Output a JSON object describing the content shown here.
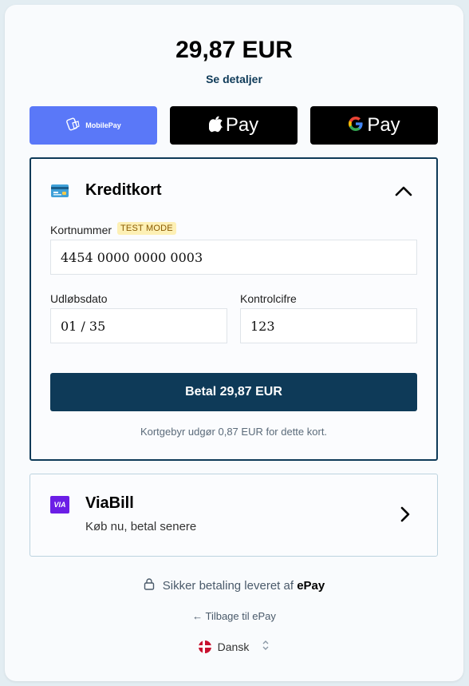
{
  "summary": {
    "amount": "29,87 EUR",
    "details_link": "Se detaljer"
  },
  "wallets": {
    "mobilepay_label": "MobilePay",
    "applepay_label": "Pay",
    "googlepay_label": "Pay"
  },
  "credit_card": {
    "title": "Kreditkort",
    "card_number_label": "Kortnummer",
    "test_mode_badge": "TEST MODE",
    "card_number_value": "4454 0000 0000 0003",
    "expiry_label": "Udløbsdato",
    "expiry_value": "01 / 35",
    "cvc_label": "Kontrolcifre",
    "cvc_value": "123",
    "pay_button": "Betal 29,87 EUR",
    "fee_note": "Kortgebyr udgør 0,87 EUR for dette kort."
  },
  "viabill": {
    "logo_text": "VIA",
    "title": "ViaBill",
    "subtitle": "Køb nu, betal senere"
  },
  "footer": {
    "secure_text": "Sikker betaling leveret af",
    "provider": "ePay",
    "back_link": "← Tilbage til ePay",
    "language": "Dansk"
  },
  "colors": {
    "primary": "#0e3a58",
    "mobilepay": "#5a78f8",
    "viabill": "#6b1ee6",
    "badge_bg": "#fdf0b5"
  }
}
